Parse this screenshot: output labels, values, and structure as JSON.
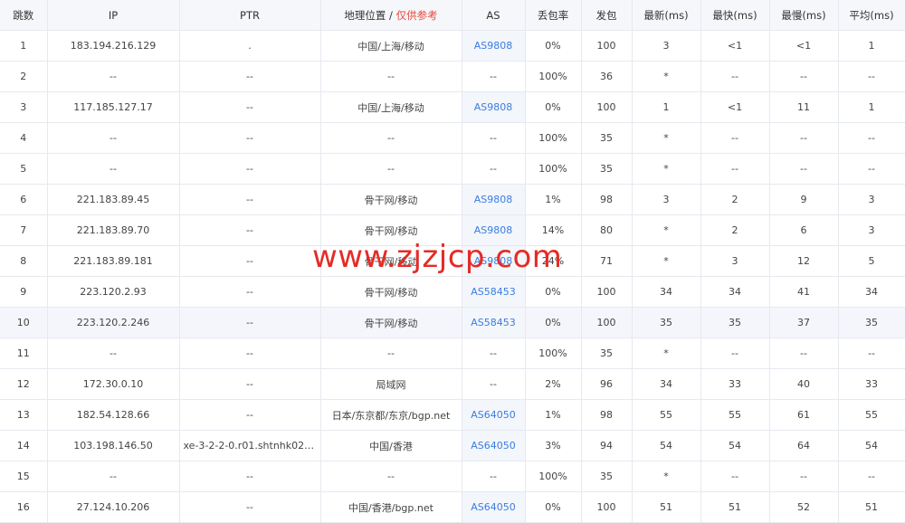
{
  "columns": {
    "hop": "跳数",
    "ip": "IP",
    "ptr": "PTR",
    "geo_main": "地理位置 / ",
    "geo_note": "仅供参考",
    "as": "AS",
    "loss": "丢包率",
    "sent": "发包",
    "last": "最新(ms)",
    "best": "最快(ms)",
    "worst": "最慢(ms)",
    "avg": "平均(ms)"
  },
  "rows": [
    {
      "hop": "1",
      "ip": "183.194.216.129",
      "ptr": ".",
      "geo": "中国/上海/移动",
      "as": "AS9808",
      "loss": "0%",
      "sent": "100",
      "last": "3",
      "best": "<1",
      "worst": "<1",
      "avg": "1"
    },
    {
      "hop": "2",
      "ip": "--",
      "ptr": "--",
      "geo": "--",
      "as": "--",
      "loss": "100%",
      "sent": "36",
      "last": "*",
      "best": "--",
      "worst": "--",
      "avg": "--"
    },
    {
      "hop": "3",
      "ip": "117.185.127.17",
      "ptr": "--",
      "geo": "中国/上海/移动",
      "as": "AS9808",
      "loss": "0%",
      "sent": "100",
      "last": "1",
      "best": "<1",
      "worst": "11",
      "avg": "1"
    },
    {
      "hop": "4",
      "ip": "--",
      "ptr": "--",
      "geo": "--",
      "as": "--",
      "loss": "100%",
      "sent": "35",
      "last": "*",
      "best": "--",
      "worst": "--",
      "avg": "--"
    },
    {
      "hop": "5",
      "ip": "--",
      "ptr": "--",
      "geo": "--",
      "as": "--",
      "loss": "100%",
      "sent": "35",
      "last": "*",
      "best": "--",
      "worst": "--",
      "avg": "--"
    },
    {
      "hop": "6",
      "ip": "221.183.89.45",
      "ptr": "--",
      "geo": "骨干网/移动",
      "as": "AS9808",
      "loss": "1%",
      "sent": "98",
      "last": "3",
      "best": "2",
      "worst": "9",
      "avg": "3"
    },
    {
      "hop": "7",
      "ip": "221.183.89.70",
      "ptr": "--",
      "geo": "骨干网/移动",
      "as": "AS9808",
      "loss": "14%",
      "sent": "80",
      "last": "*",
      "best": "2",
      "worst": "6",
      "avg": "3"
    },
    {
      "hop": "8",
      "ip": "221.183.89.181",
      "ptr": "--",
      "geo": "骨干网/移动",
      "as": "AS9808",
      "loss": "24%",
      "sent": "71",
      "last": "*",
      "best": "3",
      "worst": "12",
      "avg": "5"
    },
    {
      "hop": "9",
      "ip": "223.120.2.93",
      "ptr": "--",
      "geo": "骨干网/移动",
      "as": "AS58453",
      "loss": "0%",
      "sent": "100",
      "last": "34",
      "best": "34",
      "worst": "41",
      "avg": "34"
    },
    {
      "hop": "10",
      "ip": "223.120.2.246",
      "ptr": "--",
      "geo": "骨干网/移动",
      "as": "AS58453",
      "loss": "0%",
      "sent": "100",
      "last": "35",
      "best": "35",
      "worst": "37",
      "avg": "35",
      "highlight": true
    },
    {
      "hop": "11",
      "ip": "--",
      "ptr": "--",
      "geo": "--",
      "as": "--",
      "loss": "100%",
      "sent": "35",
      "last": "*",
      "best": "--",
      "worst": "--",
      "avg": "--"
    },
    {
      "hop": "12",
      "ip": "172.30.0.10",
      "ptr": "--",
      "geo": "局域网",
      "as": "--",
      "loss": "2%",
      "sent": "96",
      "last": "34",
      "best": "33",
      "worst": "40",
      "avg": "33"
    },
    {
      "hop": "13",
      "ip": "182.54.128.66",
      "ptr": "--",
      "geo": "日本/东京都/东京/bgp.net",
      "as": "AS64050",
      "loss": "1%",
      "sent": "98",
      "last": "55",
      "best": "55",
      "worst": "61",
      "avg": "55"
    },
    {
      "hop": "14",
      "ip": "103.198.146.50",
      "ptr": "xe-3-2-2-0.r01.shtnhk02.hk....",
      "geo": "中国/香港",
      "as": "AS64050",
      "loss": "3%",
      "sent": "94",
      "last": "54",
      "best": "54",
      "worst": "64",
      "avg": "54"
    },
    {
      "hop": "15",
      "ip": "--",
      "ptr": "--",
      "geo": "--",
      "as": "--",
      "loss": "100%",
      "sent": "35",
      "last": "*",
      "best": "--",
      "worst": "--",
      "avg": "--"
    },
    {
      "hop": "16",
      "ip": "27.124.10.206",
      "ptr": "--",
      "geo": "中国/香港/bgp.net",
      "as": "AS64050",
      "loss": "0%",
      "sent": "100",
      "last": "51",
      "best": "51",
      "worst": "52",
      "avg": "51"
    }
  ],
  "watermark": "www.zjzjcp.com",
  "colors": {
    "link": "#3b7de0",
    "note": "#e8483c",
    "watermark": "#e52b26"
  }
}
